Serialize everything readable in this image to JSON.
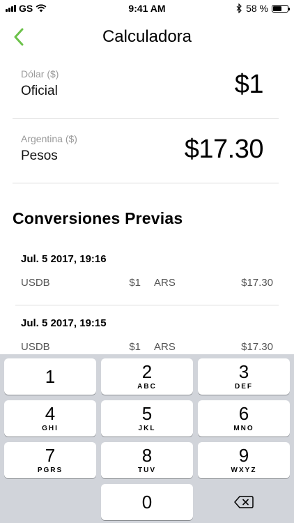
{
  "status_bar": {
    "carrier": "GS",
    "time": "9:41 AM",
    "battery": "58 %",
    "battery_level": 0.58
  },
  "nav": {
    "title": "Calculadora"
  },
  "currencies": [
    {
      "label": "Dólar ($)",
      "name": "Oficial",
      "value": "$1"
    },
    {
      "label": "Argentina ($)",
      "name": "Pesos",
      "value": "$17.30"
    }
  ],
  "history": {
    "title": "Conversiones Previas",
    "items": [
      {
        "date": "Jul. 5 2017, 19:16",
        "from": "USDB",
        "from_amount": "$1",
        "to": "ARS",
        "to_amount": "$17.30"
      },
      {
        "date": "Jul. 5 2017, 19:15",
        "from": "USDB",
        "from_amount": "$1",
        "to": "ARS",
        "to_amount": "$17.30"
      }
    ]
  },
  "keypad": {
    "keys": [
      {
        "num": "1",
        "letters": ""
      },
      {
        "num": "2",
        "letters": "ABC"
      },
      {
        "num": "3",
        "letters": "DEF"
      },
      {
        "num": "4",
        "letters": "GHI"
      },
      {
        "num": "5",
        "letters": "JKL"
      },
      {
        "num": "6",
        "letters": "MNO"
      },
      {
        "num": "7",
        "letters": "PGRS"
      },
      {
        "num": "8",
        "letters": "TUV"
      },
      {
        "num": "9",
        "letters": "WXYZ"
      },
      {
        "num": "0",
        "letters": ""
      }
    ],
    "delete_icon": "backspace-icon"
  },
  "colors": {
    "accent": "#6cc24a",
    "keypad_bg": "#d1d4da",
    "divider": "#dcdcdc"
  }
}
